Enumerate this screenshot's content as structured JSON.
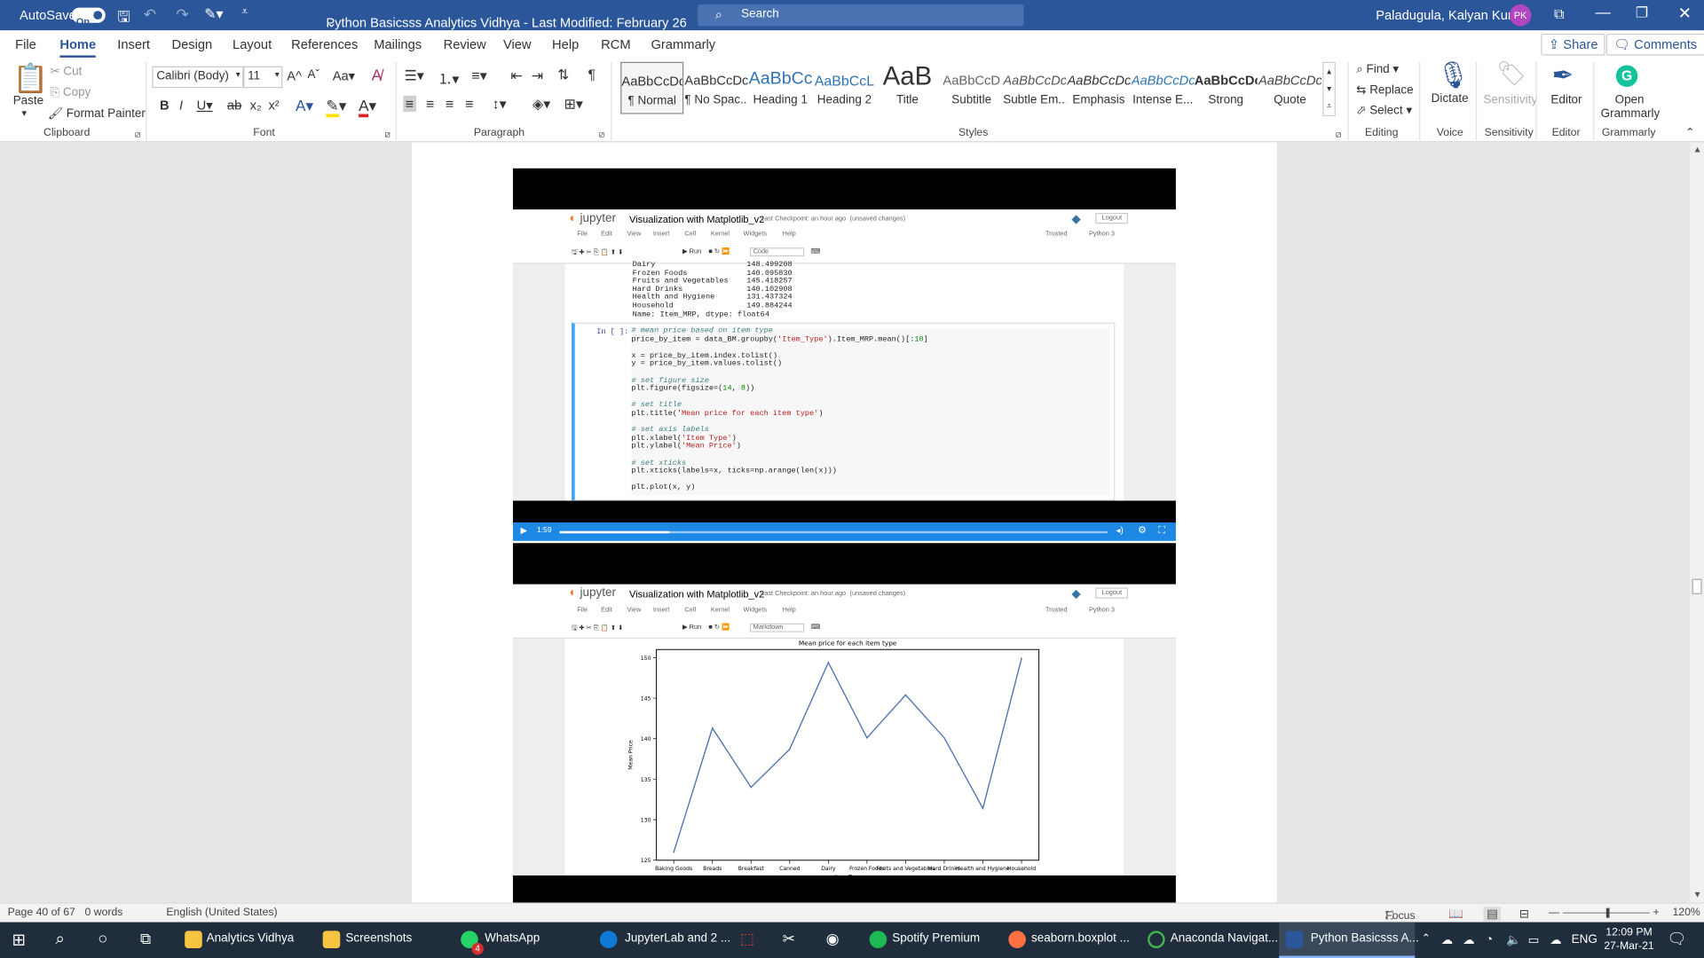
{
  "titlebar": {
    "autosave": "AutoSave",
    "toggle": "On",
    "title": "Python Basicsss Analytics Vidhya  -  Last Modified: February 26",
    "title_caret": "⌄",
    "search": "Search",
    "user": "Paladugula, Kalyan Kumar",
    "initials": "PK"
  },
  "tabs": [
    "File",
    "Home",
    "Insert",
    "Design",
    "Layout",
    "References",
    "Mailings",
    "Review",
    "View",
    "Help",
    "RCM",
    "Grammarly"
  ],
  "share": "Share",
  "comments": "Comments",
  "clipboard": {
    "paste": "Paste",
    "cut": "Cut",
    "copy": "Copy",
    "format_painter": "Format Painter",
    "label": "Clipboard"
  },
  "font": {
    "name": "Calibri (Body)",
    "size": "11",
    "label": "Font",
    "bold": "B",
    "italic": "I",
    "underline": "U",
    "strike": "ab",
    "sub": "x₂",
    "sup": "x²",
    "grow": "A^",
    "shrink": "Aˇ",
    "case": "Aa"
  },
  "paragraph": {
    "label": "Paragraph"
  },
  "styles": {
    "label": "Styles",
    "items": [
      {
        "preview": "AaBbCcDc",
        "name": "¶ Normal"
      },
      {
        "preview": "AaBbCcDc",
        "name": "¶ No Spac..."
      },
      {
        "preview": "AaBbCc",
        "name": "Heading 1"
      },
      {
        "preview": "AaBbCcL",
        "name": "Heading 2"
      },
      {
        "preview": "AaB",
        "name": "Title"
      },
      {
        "preview": "AaBbCcD",
        "name": "Subtitle"
      },
      {
        "preview": "AaBbCcDc",
        "name": "Subtle Em..."
      },
      {
        "preview": "AaBbCcDc",
        "name": "Emphasis"
      },
      {
        "preview": "AaBbCcDc",
        "name": "Intense E..."
      },
      {
        "preview": "AaBbCcDc",
        "name": "Strong"
      },
      {
        "preview": "AaBbCcDc",
        "name": "Quote"
      }
    ]
  },
  "editing": {
    "find": "Find",
    "replace": "Replace",
    "select": "Select",
    "label": "Editing"
  },
  "voice": {
    "dictate": "Dictate",
    "label": "Voice"
  },
  "sensitivity": {
    "btn": "Sensitivity",
    "label": "Sensitivity"
  },
  "editor": {
    "btn": "Editor",
    "label": "Editor"
  },
  "grammarly": {
    "btn1": "Open",
    "btn2": "Grammarly",
    "label": "Grammarly"
  },
  "jupyter": {
    "logo": "jupyter",
    "title": "Visualization with Matplotlib_v2",
    "checkpoint": "Last Checkpoint: an hour ago",
    "unsaved": "(unsaved changes)",
    "logout": "Logout",
    "menu": [
      "File",
      "Edit",
      "View",
      "Insert",
      "Cell",
      "Kernel",
      "Widgets",
      "Help"
    ],
    "trusted": "Trusted",
    "kernel": "Python 3",
    "run": "Run",
    "celltype1": "Code",
    "celltype2": "Markdown",
    "prompt": "In [ ]:"
  },
  "output_lines": [
    "Dairy                    148.499208",
    "Frozen Foods             140.095830",
    "Fruits and Vegetables    145.418257",
    "Hard Drinks              140.102908",
    "Health and Hygiene       131.437324",
    "Household                149.884244",
    "Name: Item_MRP, dtype: float64"
  ],
  "video": {
    "time": "1:59",
    "progress": 0.2
  },
  "chart_data": {
    "type": "line",
    "title": "Mean price for each item type",
    "xlabel": "Item Type",
    "ylabel": "Mean Price",
    "categories": [
      "Baking Goods",
      "Breads",
      "Breakfast",
      "Canned",
      "Dairy",
      "Frozen Foods",
      "Fruits and Vegetables",
      "Hard Drinks",
      "Health and Hygiene",
      "Household"
    ],
    "values": [
      126.0,
      141.3,
      134.0,
      138.7,
      149.4,
      140.1,
      145.4,
      140.1,
      131.4,
      149.9
    ],
    "ylim": [
      125,
      151
    ],
    "yticks": [
      125,
      130,
      135,
      140,
      145,
      150
    ],
    "grid": false
  },
  "status": {
    "page": "Page 40 of 67",
    "words": "0 words",
    "language": "English (United States)",
    "focus": "Focus",
    "zoom": "120%"
  },
  "taskbar": {
    "items": [
      "Analytics Vidhya",
      "Screenshots",
      "WhatsApp",
      "JupyterLab and 2 ...",
      "Spotify Premium",
      "seaborn.boxplot ...",
      "Anaconda Navigat...",
      "Python Basicsss A..."
    ],
    "whatsapp_badge": "4",
    "lang": "ENG",
    "time": "12:09 PM",
    "date": "27-Mar-21"
  }
}
